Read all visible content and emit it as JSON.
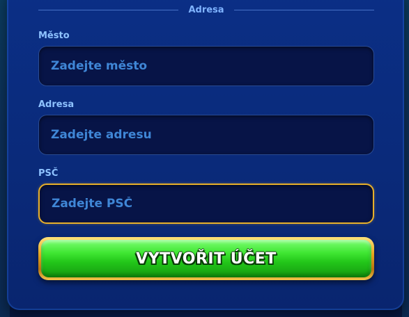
{
  "section": {
    "title": "Adresa"
  },
  "fields": [
    {
      "label": "Město",
      "placeholder": "Zadejte město",
      "value": ""
    },
    {
      "label": "Adresa",
      "placeholder": "Zadejte adresu",
      "value": ""
    },
    {
      "label": "PSČ",
      "placeholder": "Zadejte PSČ",
      "value": "",
      "focused": true
    }
  ],
  "submit": {
    "label": "VYTVOŘIT ÚČET"
  },
  "colors": {
    "accent_focus": "#e8b02a",
    "button_green": "#3fe632",
    "label_blue": "#8ec2ff",
    "placeholder_blue": "#3f86d6"
  }
}
